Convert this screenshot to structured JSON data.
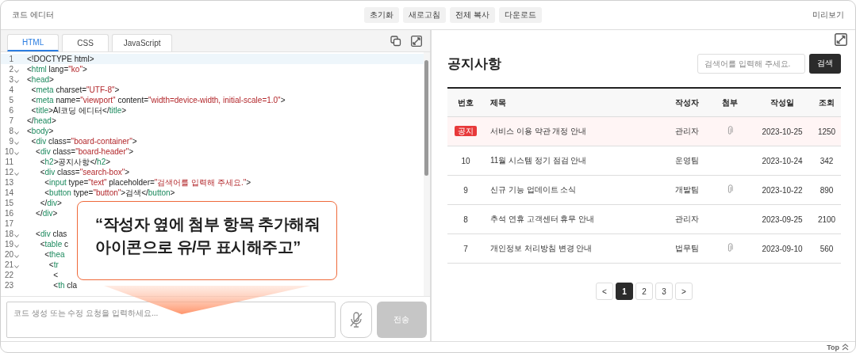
{
  "header": {
    "title": "코드 에디터",
    "actions": [
      "초기화",
      "새로고침",
      "전체 복사",
      "다운로드"
    ],
    "preview_label": "미리보기"
  },
  "editor": {
    "tabs": [
      {
        "label": "HTML",
        "selected": true
      },
      {
        "label": "CSS",
        "selected": false
      },
      {
        "label": "JavaScript",
        "selected": false
      }
    ],
    "lines": [
      {
        "number": "1",
        "foldable": false,
        "current": true,
        "tokens": [
          {
            "kind": "plain",
            "text": "<!DOCTYPE html>"
          }
        ]
      },
      {
        "number": "2",
        "foldable": true,
        "current": false,
        "tokens": [
          {
            "kind": "plain",
            "text": "<"
          },
          {
            "kind": "tag",
            "text": "html"
          },
          {
            "kind": "plain",
            "text": " lang="
          },
          {
            "kind": "string",
            "text": "\"ko\""
          },
          {
            "kind": "plain",
            "text": ">"
          }
        ]
      },
      {
        "number": "3",
        "foldable": true,
        "current": false,
        "tokens": [
          {
            "kind": "plain",
            "text": "<"
          },
          {
            "kind": "tag",
            "text": "head"
          },
          {
            "kind": "plain",
            "text": ">"
          }
        ]
      },
      {
        "number": "4",
        "foldable": false,
        "current": false,
        "tokens": [
          {
            "kind": "plain",
            "text": "  <"
          },
          {
            "kind": "tag",
            "text": "meta"
          },
          {
            "kind": "plain",
            "text": " charset="
          },
          {
            "kind": "string",
            "text": "\"UTF-8\""
          },
          {
            "kind": "plain",
            "text": ">"
          }
        ]
      },
      {
        "number": "5",
        "foldable": false,
        "current": false,
        "tokens": [
          {
            "kind": "plain",
            "text": "  <"
          },
          {
            "kind": "tag",
            "text": "meta"
          },
          {
            "kind": "plain",
            "text": " name="
          },
          {
            "kind": "string",
            "text": "\"viewport\""
          },
          {
            "kind": "plain",
            "text": " content="
          },
          {
            "kind": "string",
            "text": "\"width=device-width, initial-scale=1.0\""
          },
          {
            "kind": "plain",
            "text": ">"
          }
        ]
      },
      {
        "number": "6",
        "foldable": false,
        "current": false,
        "tokens": [
          {
            "kind": "plain",
            "text": "  <"
          },
          {
            "kind": "tag",
            "text": "title"
          },
          {
            "kind": "plain",
            "text": ">AI코딩 에디터</"
          },
          {
            "kind": "tag",
            "text": "title"
          },
          {
            "kind": "plain",
            "text": ">"
          }
        ]
      },
      {
        "number": "7",
        "foldable": false,
        "current": false,
        "tokens": [
          {
            "kind": "plain",
            "text": "</"
          },
          {
            "kind": "tag",
            "text": "head"
          },
          {
            "kind": "plain",
            "text": ">"
          }
        ]
      },
      {
        "number": "8",
        "foldable": true,
        "current": false,
        "tokens": [
          {
            "kind": "plain",
            "text": "<"
          },
          {
            "kind": "tag",
            "text": "body"
          },
          {
            "kind": "plain",
            "text": ">"
          }
        ]
      },
      {
        "number": "9",
        "foldable": true,
        "current": false,
        "tokens": [
          {
            "kind": "plain",
            "text": "  <"
          },
          {
            "kind": "tag",
            "text": "div"
          },
          {
            "kind": "plain",
            "text": " class="
          },
          {
            "kind": "string",
            "text": "\"board-container\""
          },
          {
            "kind": "plain",
            "text": ">"
          }
        ]
      },
      {
        "number": "10",
        "foldable": true,
        "current": false,
        "tokens": [
          {
            "kind": "plain",
            "text": "    <"
          },
          {
            "kind": "tag",
            "text": "div"
          },
          {
            "kind": "plain",
            "text": " class="
          },
          {
            "kind": "string",
            "text": "\"board-header\""
          },
          {
            "kind": "plain",
            "text": ">"
          }
        ]
      },
      {
        "number": "11",
        "foldable": false,
        "current": false,
        "tokens": [
          {
            "kind": "plain",
            "text": "      <"
          },
          {
            "kind": "tag",
            "text": "h2"
          },
          {
            "kind": "plain",
            "text": ">공지사항</"
          },
          {
            "kind": "tag",
            "text": "h2"
          },
          {
            "kind": "plain",
            "text": ">"
          }
        ]
      },
      {
        "number": "12",
        "foldable": true,
        "current": false,
        "tokens": [
          {
            "kind": "plain",
            "text": "      <"
          },
          {
            "kind": "tag",
            "text": "div"
          },
          {
            "kind": "plain",
            "text": " class="
          },
          {
            "kind": "string",
            "text": "\"search-box\""
          },
          {
            "kind": "plain",
            "text": ">"
          }
        ]
      },
      {
        "number": "13",
        "foldable": false,
        "current": false,
        "tokens": [
          {
            "kind": "plain",
            "text": "        <"
          },
          {
            "kind": "tag",
            "text": "input"
          },
          {
            "kind": "plain",
            "text": " type="
          },
          {
            "kind": "string",
            "text": "\"text\""
          },
          {
            "kind": "plain",
            "text": " placeholder="
          },
          {
            "kind": "string",
            "text": "\"검색어를 입력해 주세요.\""
          },
          {
            "kind": "plain",
            "text": ">"
          }
        ]
      },
      {
        "number": "14",
        "foldable": false,
        "current": false,
        "tokens": [
          {
            "kind": "plain",
            "text": "        <"
          },
          {
            "kind": "tag",
            "text": "button"
          },
          {
            "kind": "plain",
            "text": " type="
          },
          {
            "kind": "string",
            "text": "\"button\""
          },
          {
            "kind": "plain",
            "text": ">검색</"
          },
          {
            "kind": "tag",
            "text": "button"
          },
          {
            "kind": "plain",
            "text": ">"
          }
        ]
      },
      {
        "number": "15",
        "foldable": false,
        "current": false,
        "tokens": [
          {
            "kind": "plain",
            "text": "      </"
          },
          {
            "kind": "tag",
            "text": "div"
          },
          {
            "kind": "plain",
            "text": ">"
          }
        ]
      },
      {
        "number": "16",
        "foldable": false,
        "current": false,
        "tokens": [
          {
            "kind": "plain",
            "text": "    </"
          },
          {
            "kind": "tag",
            "text": "div"
          },
          {
            "kind": "plain",
            "text": ">"
          }
        ]
      },
      {
        "number": "17",
        "foldable": false,
        "current": false
      },
      {
        "number": "18",
        "foldable": true,
        "current": false,
        "tokens": [
          {
            "kind": "plain",
            "text": "    <"
          },
          {
            "kind": "tag",
            "text": "div"
          },
          {
            "kind": "plain",
            "text": " clas"
          }
        ]
      },
      {
        "number": "19",
        "foldable": true,
        "current": false,
        "tokens": [
          {
            "kind": "plain",
            "text": "      <"
          },
          {
            "kind": "tag",
            "text": "table"
          },
          {
            "kind": "plain",
            "text": " c"
          }
        ]
      },
      {
        "number": "20",
        "foldable": true,
        "current": false,
        "tokens": [
          {
            "kind": "plain",
            "text": "        <"
          },
          {
            "kind": "tag",
            "text": "thea"
          }
        ]
      },
      {
        "number": "21",
        "foldable": true,
        "current": false,
        "tokens": [
          {
            "kind": "plain",
            "text": "          <"
          },
          {
            "kind": "tag",
            "text": "tr"
          }
        ]
      },
      {
        "number": "22",
        "foldable": false,
        "current": false,
        "tokens": [
          {
            "kind": "plain",
            "text": "            <"
          }
        ]
      },
      {
        "number": "23",
        "foldable": false,
        "current": false,
        "tokens": [
          {
            "kind": "plain",
            "text": "            <"
          },
          {
            "kind": "tag",
            "text": "th"
          },
          {
            "kind": "plain",
            "text": " cla"
          }
        ]
      }
    ]
  },
  "callout": {
    "lines": [
      "“작성자 옆에 첨부 항목 추가해줘",
      "아이콘으로 유/무 표시해주고”"
    ]
  },
  "prompt": {
    "placeholder": "코드 생성 또는 수정 요청을 입력하세요...",
    "send_label": "전송",
    "send_disabled": true
  },
  "preview": {
    "title": "공지사항",
    "search": {
      "placeholder": "검색어를 입력해 주세요.",
      "button": "검색"
    },
    "table": {
      "columns": [
        "번호",
        "제목",
        "작성자",
        "첨부",
        "작성일",
        "조회"
      ],
      "rows": [
        {
          "pinned": true,
          "badge": "공지",
          "title": "서비스 이용 약관 개정 안내",
          "author": "관리자",
          "attachment": true,
          "date": "2023-10-25",
          "views": "1250"
        },
        {
          "pinned": false,
          "number": "10",
          "title": "11월 시스템 정기 점검 안내",
          "author": "운영팀",
          "attachment": false,
          "date": "2023-10-24",
          "views": "342"
        },
        {
          "pinned": false,
          "number": "9",
          "title": "신규 기능 업데이트 소식",
          "author": "개발팀",
          "attachment": true,
          "date": "2023-10-22",
          "views": "890"
        },
        {
          "pinned": false,
          "number": "8",
          "title": "추석 연휴 고객센터 휴무 안내",
          "author": "관리자",
          "attachment": false,
          "date": "2023-09-25",
          "views": "2100"
        },
        {
          "pinned": false,
          "number": "7",
          "title": "개인정보 처리방침 변경 안내",
          "author": "법무팀",
          "attachment": true,
          "date": "2023-09-10",
          "views": "560"
        }
      ]
    },
    "pagination": {
      "prev": "<",
      "next": ">",
      "pages": [
        {
          "label": "1",
          "selected": true
        },
        {
          "label": "2",
          "selected": false
        },
        {
          "label": "3",
          "selected": false
        }
      ]
    }
  },
  "footer": {
    "top_label": "Top"
  }
}
